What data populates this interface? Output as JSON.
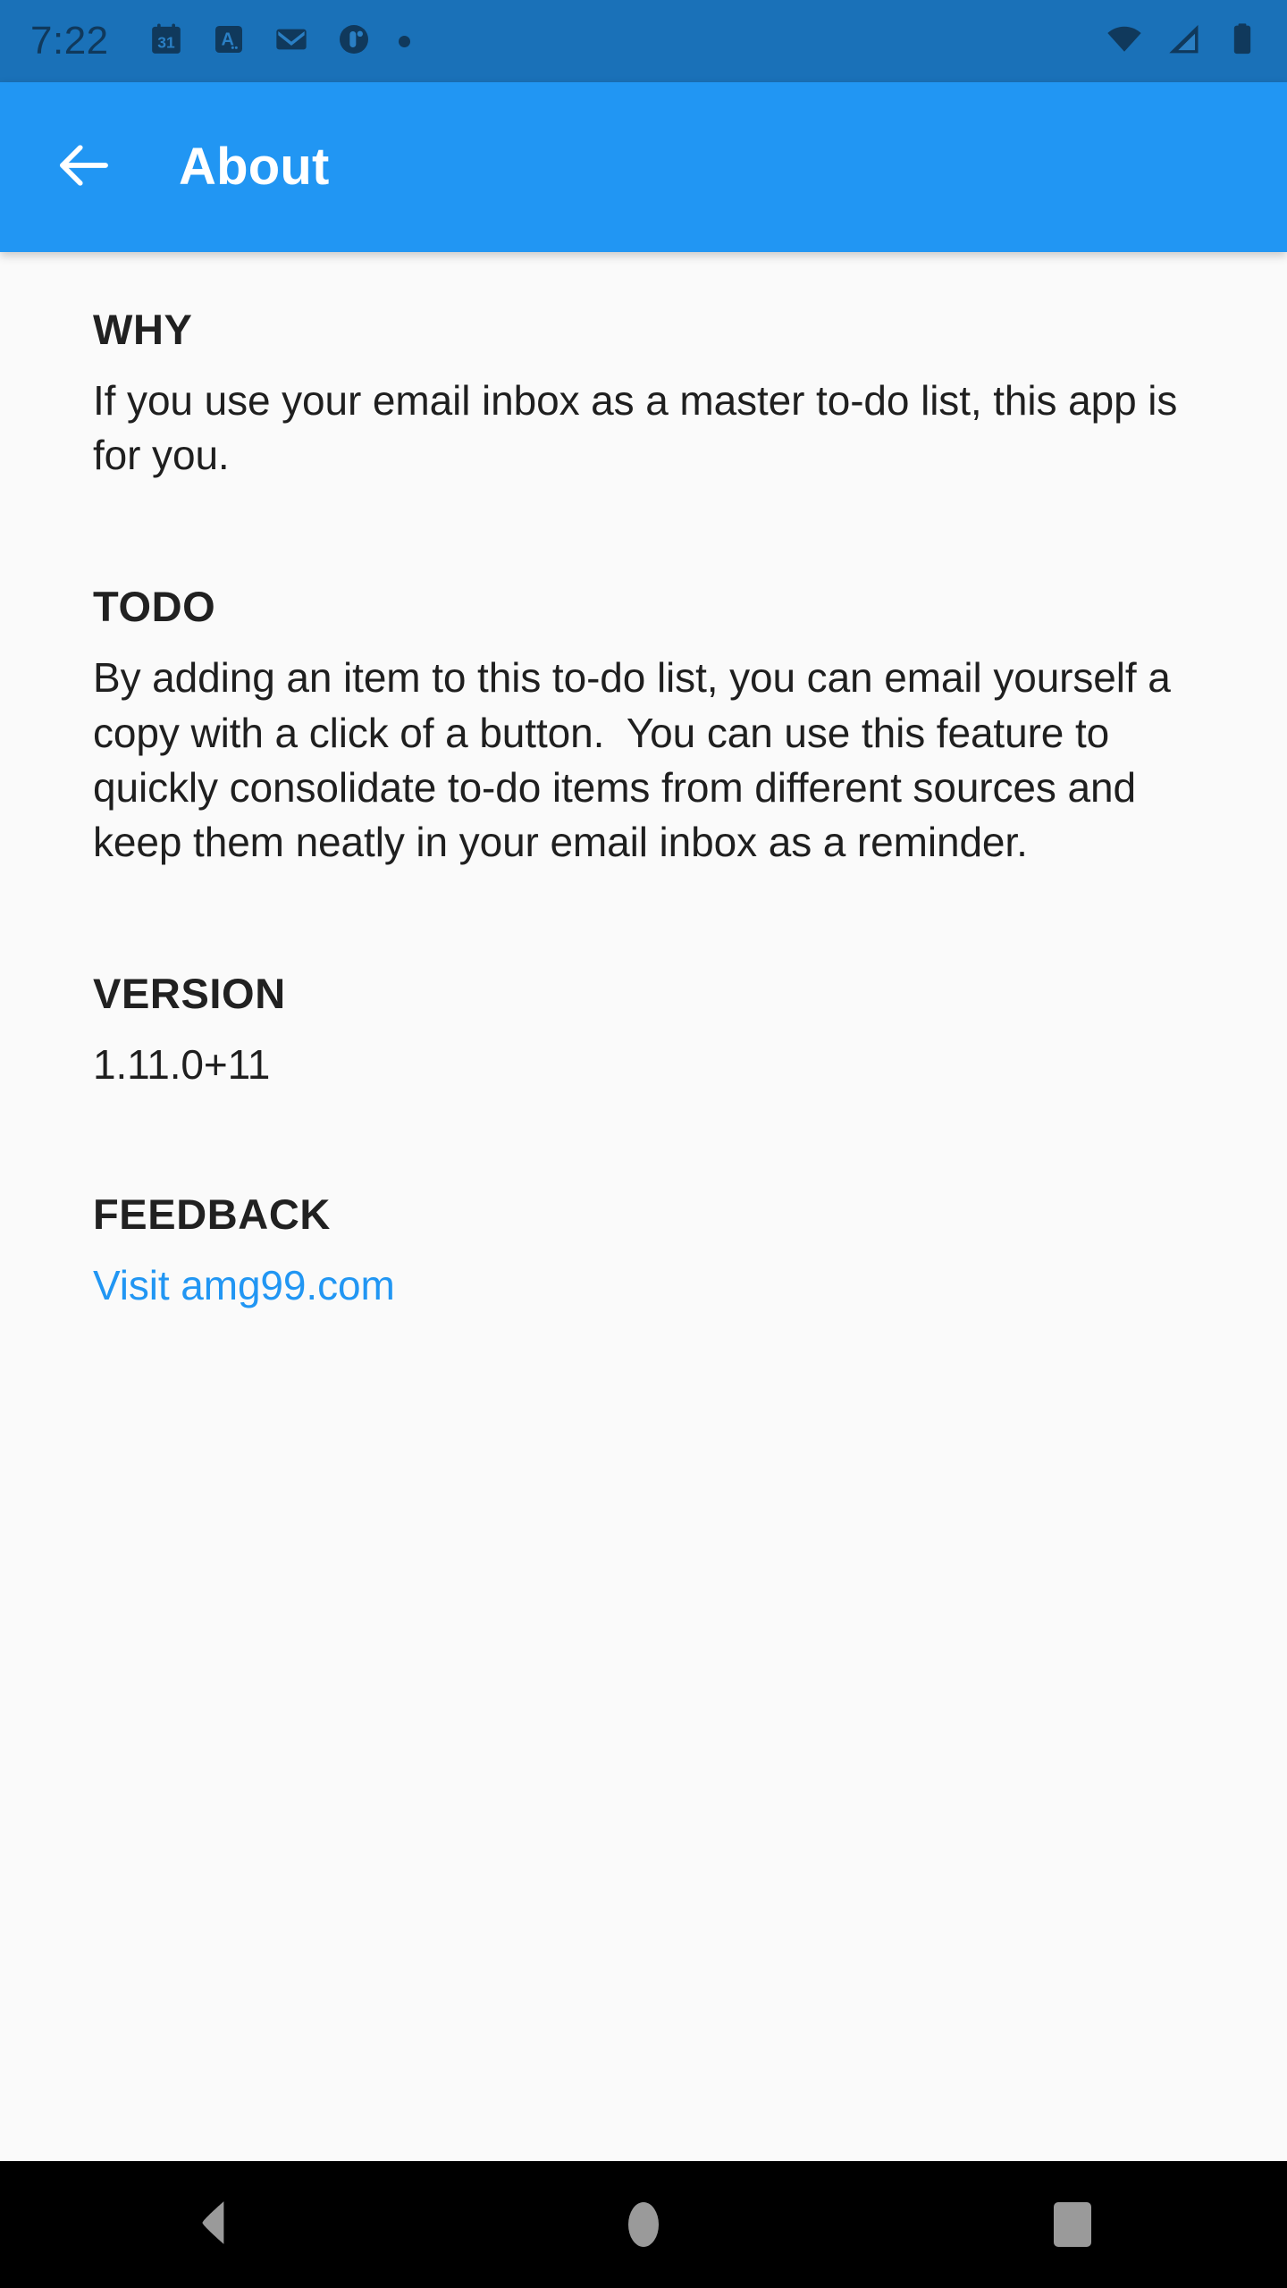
{
  "status_bar": {
    "time": "7:22",
    "background_color": "#1A71B8",
    "icon_color": "#10395C",
    "left_icons": [
      "calendar-31-icon",
      "translate-a-icon",
      "gmail-icon",
      "pocket-casts-icon",
      "more-dot-icon"
    ],
    "right_icons": [
      "wifi-icon",
      "cellular-signal-icon",
      "battery-icon"
    ]
  },
  "app_bar": {
    "title": "About",
    "back_icon": "arrow-left-icon",
    "background_color": "#2196F3",
    "text_color": "#FFFFFF"
  },
  "content": {
    "sections": [
      {
        "heading": "WHY",
        "body": "If you use your email inbox as a master to-do list, this app is for you."
      },
      {
        "heading": "TODO",
        "body": "By adding an item to this to-do list, you can email yourself a copy with a click of a button.  You can use this feature to quickly consolidate to-do items from different sources and keep them neatly in your email inbox as a reminder."
      },
      {
        "heading": "VERSION",
        "body": "1.11.0+11"
      },
      {
        "heading": "FEEDBACK",
        "link_text": "Visit amg99.com",
        "link_color": "#2196F3"
      }
    ],
    "background_color": "#FAFAFA",
    "text_color": "#1F1F1F"
  },
  "nav_bar": {
    "background_color": "#000000",
    "icon_color": "#9A9A9A",
    "buttons": [
      {
        "name": "back",
        "icon": "triangle-back-icon"
      },
      {
        "name": "home",
        "icon": "circle-home-icon"
      },
      {
        "name": "recents",
        "icon": "square-recents-icon"
      }
    ]
  }
}
